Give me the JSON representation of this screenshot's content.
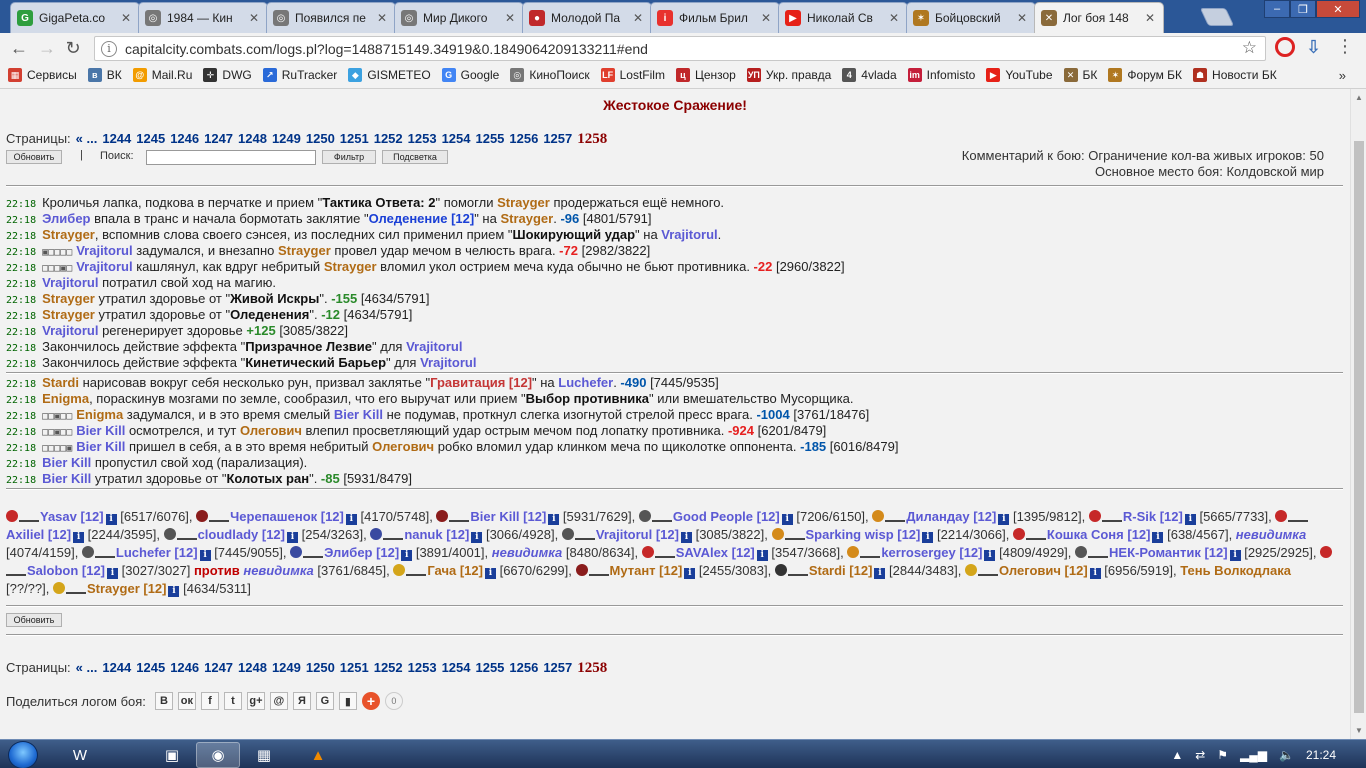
{
  "browser": {
    "tabs": [
      {
        "label": "GigaPeta.co",
        "icon": "gigapeta-icon",
        "color": "#2e9e3e",
        "glyph": "G"
      },
      {
        "label": "1984 — Кин",
        "icon": "film-reel-icon",
        "color": "#777777",
        "glyph": "◎"
      },
      {
        "label": "Появился пе",
        "icon": "film-reel-icon",
        "color": "#777777",
        "glyph": "◎"
      },
      {
        "label": "Мир Дикого",
        "icon": "film-reel-icon",
        "color": "#777777",
        "glyph": "◎"
      },
      {
        "label": "Молодой Па",
        "icon": "red-circle-icon",
        "color": "#c0282a",
        "glyph": "●"
      },
      {
        "label": "Фильм Брил",
        "icon": "ivi-icon",
        "color": "#e8312d",
        "glyph": "i"
      },
      {
        "label": "Николай Св",
        "icon": "youtube-icon",
        "color": "#e62117",
        "glyph": "▶"
      },
      {
        "label": "Бойцовский",
        "icon": "combats-icon",
        "color": "#b07820",
        "glyph": "✶"
      },
      {
        "label": "Лог боя 148",
        "icon": "swords-icon",
        "color": "#8a6a3a",
        "glyph": "✕"
      }
    ],
    "url": "capitalcity.combats.com/logs.pl?log=1488715149.34919&0.1849064209133211#end",
    "bookmarks": [
      {
        "label": "Сервисы",
        "color": "#d23f31",
        "glyph": "▦"
      },
      {
        "label": "ВК",
        "color": "#4a76a8",
        "glyph": "в"
      },
      {
        "label": "Mail.Ru",
        "color": "#f29c00",
        "glyph": "@"
      },
      {
        "label": "DWG",
        "color": "#333333",
        "glyph": "✛"
      },
      {
        "label": "RuTracker",
        "color": "#2a6ad8",
        "glyph": "↗"
      },
      {
        "label": "GISMETEO",
        "color": "#3ba1e0",
        "glyph": "◆"
      },
      {
        "label": "Google",
        "color": "#4285f4",
        "glyph": "G"
      },
      {
        "label": "КиноПоиск",
        "color": "#777777",
        "glyph": "◎"
      },
      {
        "label": "LostFilm",
        "color": "#e03f2e",
        "glyph": "LF"
      },
      {
        "label": "Цензор",
        "color": "#c0282a",
        "glyph": "ц"
      },
      {
        "label": "Укр. правда",
        "color": "#b61e1e",
        "glyph": "УП"
      },
      {
        "label": "4vlada",
        "color": "#555555",
        "glyph": "4"
      },
      {
        "label": "Infomisto",
        "color": "#c41e3a",
        "glyph": "im"
      },
      {
        "label": "YouTube",
        "color": "#e62117",
        "glyph": "▶"
      },
      {
        "label": "БК",
        "color": "#8a6a3a",
        "glyph": "✕"
      },
      {
        "label": "Форум БК",
        "color": "#b07820",
        "glyph": "✶"
      },
      {
        "label": "Новости БК",
        "color": "#b03020",
        "glyph": "☗"
      }
    ],
    "more": "»"
  },
  "page": {
    "title": "Жестокое Сражение!",
    "pages_label": "Страницы:",
    "pages_prefix": "« ...",
    "pages": [
      "1244",
      "1245",
      "1246",
      "1247",
      "1248",
      "1249",
      "1250",
      "1251",
      "1252",
      "1253",
      "1254",
      "1255",
      "1256",
      "1257"
    ],
    "current_page": "1258",
    "refresh_label": "Обновить",
    "separator": "|",
    "search_label": "Поиск:",
    "filter_label": "Фильтр",
    "highlight_label": "Подсветка",
    "comment_line1": "Комментарий к бою: Ограничение кол-ва живых игроков: 50",
    "comment_line2": "Основное место боя: Колдовской мир",
    "share_label": "Поделиться логом боя:",
    "share_buttons": [
      "В",
      "ок",
      "f",
      "t",
      "g+",
      "@",
      "Я",
      "G",
      "▮"
    ],
    "share_count": "0"
  },
  "log_block1": [
    {
      "time": "22:18",
      "parts": [
        [
          "",
          "Кроличья лапка, подкова в перчатке и прием \""
        ],
        [
          "b",
          "Тактика Ответа: 2"
        ],
        [
          "",
          "\" помогли "
        ],
        [
          "p1",
          "Strayger"
        ],
        [
          "",
          " продержаться ещё немного."
        ]
      ]
    },
    {
      "time": "22:18",
      "parts": [
        [
          "p2",
          "Элибер"
        ],
        [
          "",
          " впала в транс и начала бормотать заклятие \""
        ],
        [
          "sp",
          "Оледенение [12]"
        ],
        [
          "",
          "\" на "
        ],
        [
          "p1",
          "Strayger"
        ],
        [
          "",
          ". "
        ],
        [
          "dmgb",
          "-96"
        ],
        [
          "",
          " [4801/5791]"
        ]
      ]
    },
    {
      "time": "22:18",
      "parts": [
        [
          "p1",
          "Strayger"
        ],
        [
          "",
          ", вспомнив слова своего сэнсея, из последних сил применил прием \""
        ],
        [
          "b",
          "Шокирующий удар"
        ],
        [
          "",
          "\" на "
        ],
        [
          "p2",
          "Vrajitorul"
        ],
        [
          "",
          "."
        ]
      ]
    },
    {
      "time": "22:18",
      "zones": "▣□□□□",
      "parts": [
        [
          "p2",
          "Vrajitorul"
        ],
        [
          "",
          " задумался, и внезапно "
        ],
        [
          "p1",
          "Strayger"
        ],
        [
          "",
          " провел удар мечом в челюсть врага. "
        ],
        [
          "dmg",
          "-72"
        ],
        [
          "",
          " [2982/3822]"
        ]
      ]
    },
    {
      "time": "22:18",
      "zones": "□□□▣□",
      "parts": [
        [
          "p2",
          "Vrajitorul"
        ],
        [
          "",
          " кашлянул, как вдруг небритый "
        ],
        [
          "p1",
          "Strayger"
        ],
        [
          "",
          " вломил укол острием меча куда обычно не бьют противника. "
        ],
        [
          "dmg",
          "-22"
        ],
        [
          "",
          " [2960/3822]"
        ]
      ]
    },
    {
      "time": "22:18",
      "parts": [
        [
          "p2",
          "Vrajitorul"
        ],
        [
          "",
          " потратил свой ход на магию."
        ]
      ]
    },
    {
      "time": "22:18",
      "parts": [
        [
          "p1",
          "Strayger"
        ],
        [
          "",
          " утратил здоровье от \""
        ],
        [
          "b",
          "Живой Искры"
        ],
        [
          "",
          "\". "
        ],
        [
          "heal",
          "-155"
        ],
        [
          "",
          " [4634/5791]"
        ]
      ]
    },
    {
      "time": "22:18",
      "parts": [
        [
          "p1",
          "Strayger"
        ],
        [
          "",
          " утратил здоровье от \""
        ],
        [
          "b",
          "Оледенения"
        ],
        [
          "",
          "\". "
        ],
        [
          "heal",
          "-12"
        ],
        [
          "",
          " [4634/5791]"
        ]
      ]
    },
    {
      "time": "22:18",
      "parts": [
        [
          "p2",
          "Vrajitorul"
        ],
        [
          "",
          " регенерирует здоровье "
        ],
        [
          "heal",
          "+125"
        ],
        [
          "",
          " [3085/3822]"
        ]
      ]
    },
    {
      "time": "22:18",
      "parts": [
        [
          "",
          "Закончилось действие эффекта \""
        ],
        [
          "b",
          "Призрачное Лезвие"
        ],
        [
          "",
          "\" для "
        ],
        [
          "p2",
          "Vrajitorul"
        ]
      ]
    },
    {
      "time": "22:18",
      "parts": [
        [
          "",
          "Закончилось действие эффекта \""
        ],
        [
          "b",
          "Кинетический Барьер"
        ],
        [
          "",
          "\" для "
        ],
        [
          "p2",
          "Vrajitorul"
        ]
      ]
    }
  ],
  "log_block2": [
    {
      "time": "22:18",
      "parts": [
        [
          "p1",
          "Stardi"
        ],
        [
          "",
          " нарисовав вокруг себя несколько рун, призвал заклятье \""
        ],
        [
          "spr",
          "Гравитация [12]"
        ],
        [
          "",
          "\" на "
        ],
        [
          "p2",
          "Luchefer"
        ],
        [
          "",
          ". "
        ],
        [
          "dmgb",
          "-490"
        ],
        [
          "",
          " [7445/9535]"
        ]
      ]
    },
    {
      "time": "22:18",
      "parts": [
        [
          "p1",
          "Enigma"
        ],
        [
          "",
          ", пораскинув мозгами по земле, сообразил, что его выручат или прием \""
        ],
        [
          "b",
          "Выбор противника"
        ],
        [
          "",
          "\" или вмешательство Мусорщика."
        ]
      ]
    },
    {
      "time": "22:18",
      "zones": "□□▣□□",
      "parts": [
        [
          "p1",
          "Enigma"
        ],
        [
          "",
          " задумался, и в это время смелый "
        ],
        [
          "p2",
          "Bier Kill"
        ],
        [
          "",
          " не подумав, проткнул слегка изогнутой стрелой пресс врага. "
        ],
        [
          "dmgb",
          "-1004"
        ],
        [
          "",
          " [3761/18476]"
        ]
      ]
    },
    {
      "time": "22:18",
      "zones": "□□▣□□",
      "parts": [
        [
          "p2",
          "Bier Kill"
        ],
        [
          "",
          " осмотрелся, и тут "
        ],
        [
          "p1",
          "Олегович"
        ],
        [
          "",
          " влепил просветляющий удар острым мечом под лопатку противника. "
        ],
        [
          "dmg",
          "-924"
        ],
        [
          "",
          " [6201/8479]"
        ]
      ]
    },
    {
      "time": "22:18",
      "zones": "□□□□▣",
      "parts": [
        [
          "p2",
          "Bier Kill"
        ],
        [
          "",
          " пришел в себя, а в это время небритый "
        ],
        [
          "p1",
          "Олегович"
        ],
        [
          "",
          " робко вломил удар клинком меча по щиколотке оппонента. "
        ],
        [
          "dmgb",
          "-185"
        ],
        [
          "",
          " [6016/8479]"
        ]
      ]
    },
    {
      "time": "22:18",
      "parts": [
        [
          "p2",
          "Bier Kill"
        ],
        [
          "",
          " пропустил свой ход (парализация)."
        ]
      ]
    },
    {
      "time": "22:18",
      "parts": [
        [
          "p2",
          "Bier Kill"
        ],
        [
          "",
          " утратил здоровье от \""
        ],
        [
          "b",
          "Колотых ран"
        ],
        [
          "",
          "\". "
        ],
        [
          "heal",
          "-85"
        ],
        [
          "",
          " [5931/8479]"
        ]
      ]
    }
  ],
  "team1": [
    {
      "name": "Yasav [12]",
      "hp": "[6517/6076]",
      "c": "#c62828"
    },
    {
      "name": "Черепашенок [12]",
      "hp": "[4170/5748]",
      "c": "#8a1c1c"
    },
    {
      "name": "Bier Kill [12]",
      "hp": "[5931/7629]",
      "c": "#8a1c1c"
    },
    {
      "name": "Good People [12]",
      "hp": "[7206/6150]",
      "c": "#555555"
    },
    {
      "name": "Диландау [12]",
      "hp": "[1395/9812]",
      "c": "#d48a1a"
    },
    {
      "name": "R-Sik [12]",
      "hp": "[5665/7733]",
      "c": "#c62828"
    },
    {
      "name": "Axiliel [12]",
      "hp": "[2244/3595]",
      "c": "#c62828"
    },
    {
      "name": "cloudlady [12]",
      "hp": "[254/3263]",
      "c": "#555555"
    },
    {
      "name": "nanuk [12]",
      "hp": "[3066/4928]",
      "c": "#3a4aa0"
    },
    {
      "name": "Vrajitorul [12]",
      "hp": "[3085/3822]",
      "c": "#555555"
    },
    {
      "name": "Sparking wisp [12]",
      "hp": "[2214/3066]",
      "c": "#d48a1a"
    },
    {
      "name": "Кошка Соня [12]",
      "hp": "[638/4567]",
      "c": "#c62828"
    },
    {
      "name": "невидимка",
      "hp": "[4074/4159]",
      "c": "",
      "inv": true
    },
    {
      "name": "Luchefer [12]",
      "hp": "[7445/9055]",
      "c": "#555555"
    },
    {
      "name": "Элибер [12]",
      "hp": "[3891/4001]",
      "c": "#3a4aa0"
    },
    {
      "name": "невидимка",
      "hp": "[8480/8634]",
      "c": "",
      "inv": true
    },
    {
      "name": "SAVAlex [12]",
      "hp": "[3547/3668]",
      "c": "#c62828"
    },
    {
      "name": "kerrosergey [12]",
      "hp": "[4809/4929]",
      "c": "#d48a1a"
    },
    {
      "name": "НЕК-Романтик [12]",
      "hp": "[2925/2925]",
      "c": "#555555"
    },
    {
      "name": "Salobon [12]",
      "hp": "[3027/3027]",
      "c": "#c62828"
    }
  ],
  "versus": "против",
  "team2": [
    {
      "name": "невидимка",
      "hp": "[3761/6845]",
      "c": "",
      "inv": true
    },
    {
      "name": "Гача [12]",
      "hp": "[6670/6299]",
      "c": "#d4a51a"
    },
    {
      "name": "Мутант [12]",
      "hp": "[2455/3083]",
      "c": "#8a1c1c"
    },
    {
      "name": "Stardi [12]",
      "hp": "[2844/3483]",
      "c": "#333333"
    },
    {
      "name": "Олегович [12]",
      "hp": "[6956/5919]",
      "c": "#d4a51a"
    },
    {
      "name": "Тень Волкодлака",
      "hp": "[??/??]",
      "c": "",
      "plain": true
    },
    {
      "name": "Strayger [12]",
      "hp": "[4634/5311]",
      "c": "#d4a51a"
    }
  ],
  "taskbar": {
    "clock": "21:24",
    "apps": [
      "word-icon",
      "save-icon",
      "chrome-icon",
      "calculator-icon",
      "vlc-icon"
    ]
  }
}
